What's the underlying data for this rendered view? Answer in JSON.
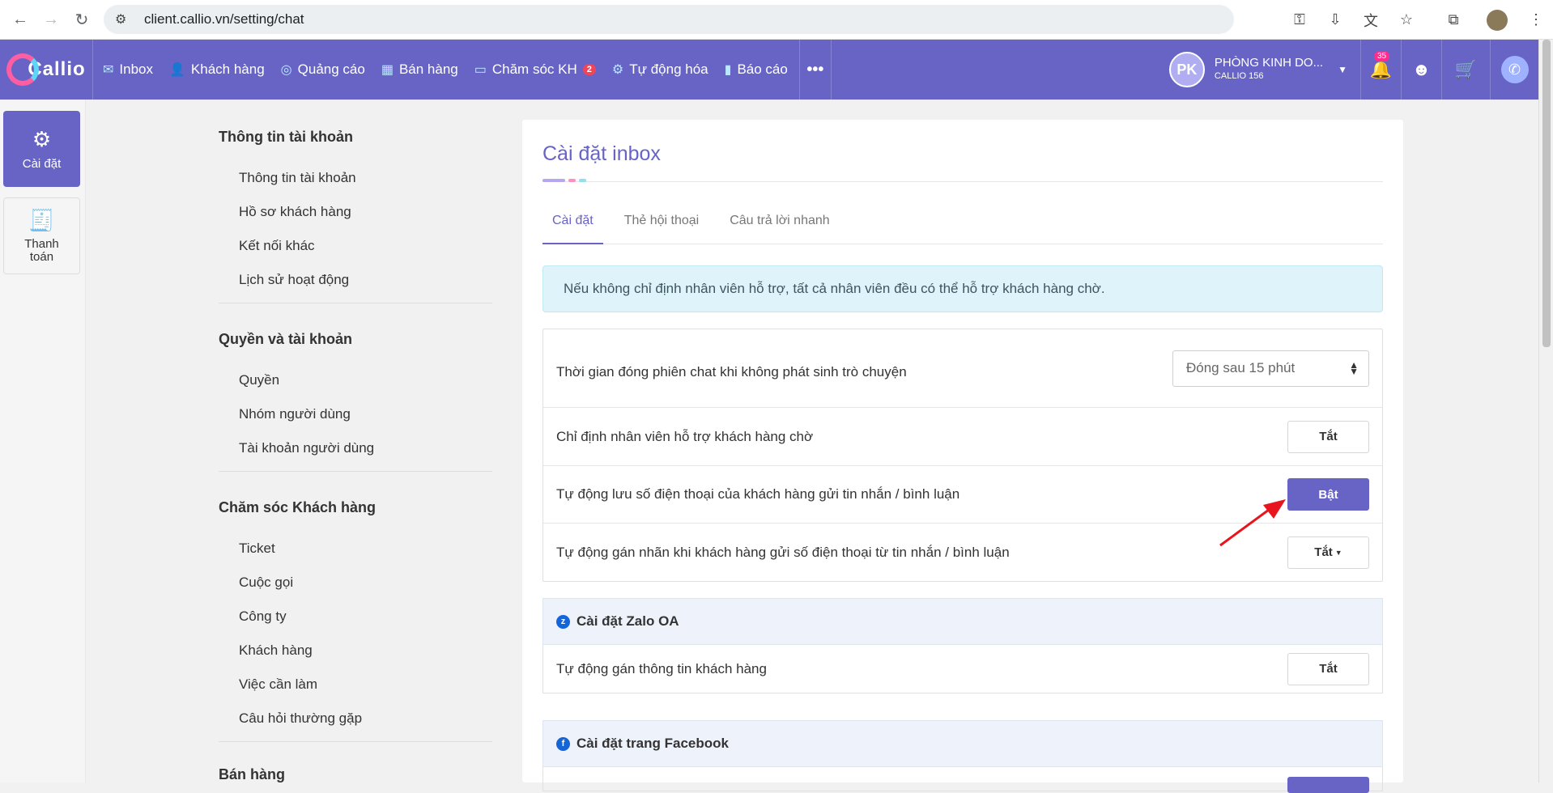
{
  "browser": {
    "url": "client.callio.vn/setting/chat"
  },
  "app": {
    "logo_text": "Callio",
    "menu": [
      {
        "label": "Inbox",
        "icon": "inbox-icon"
      },
      {
        "label": "Khách hàng",
        "icon": "customer-icon"
      },
      {
        "label": "Quảng cáo",
        "icon": "ads-icon"
      },
      {
        "label": "Bán hàng",
        "icon": "sales-icon"
      },
      {
        "label": "Chăm sóc KH",
        "icon": "ticket-icon",
        "badge": "2"
      },
      {
        "label": "Tự động hóa",
        "icon": "robot-icon"
      },
      {
        "label": "Báo cáo",
        "icon": "chart-icon"
      }
    ],
    "more_label": "•••",
    "user": {
      "initials": "PK",
      "name": "PHÒNG KINH DO...",
      "subtitle": "CALLIO 156"
    },
    "notification_count": "35"
  },
  "rail": {
    "settings_label": "Cài đặt",
    "billing_label": "Thanh toán"
  },
  "sidenav": {
    "sections": [
      {
        "title": "Thông tin tài khoản",
        "items": [
          "Thông tin tài khoản",
          "Hồ sơ khách hàng",
          "Kết nối khác",
          "Lịch sử hoạt động"
        ]
      },
      {
        "title": "Quyền và tài khoản",
        "items": [
          "Quyền",
          "Nhóm người dùng",
          "Tài khoản người dùng"
        ]
      },
      {
        "title": "Chăm sóc Khách hàng",
        "items": [
          "Ticket",
          "Cuộc gọi",
          "Công ty",
          "Khách hàng",
          "Việc cần làm",
          "Câu hỏi thường gặp"
        ]
      },
      {
        "title": "Bán hàng",
        "items": []
      }
    ]
  },
  "main": {
    "title": "Cài đặt inbox",
    "tabs": [
      "Cài đặt",
      "Thẻ hội thoại",
      "Câu trả lời nhanh"
    ],
    "alert": "Nếu không chỉ định nhân viên hỗ trợ, tất cả nhân viên đều có thể hỗ trợ khách hàng chờ.",
    "settings": [
      {
        "label": "Thời gian đóng phiên chat khi không phát sinh trò chuyện",
        "control": "select",
        "value": "Đóng sau 15 phút"
      },
      {
        "label": "Chỉ định nhân viên hỗ trợ khách hàng chờ",
        "control": "button",
        "value": "Tắt"
      },
      {
        "label": "Tự động lưu số điện thoại của khách hàng gửi tin nhắn / bình luận",
        "control": "button",
        "value": "Bật"
      },
      {
        "label": "Tự động gán nhãn khi khách hàng gửi số điện thoại từ tin nhắn / bình luận",
        "control": "dropdown-button",
        "value": "Tắt"
      }
    ],
    "zalo": {
      "heading": "Cài đặt Zalo OA",
      "row_label": "Tự động gán thông tin khách hàng",
      "row_value": "Tắt"
    },
    "facebook": {
      "heading": "Cài đặt trang Facebook"
    }
  },
  "colors": {
    "brand": "#6764c6",
    "alert_bg": "#dff4fa",
    "annotation_arrow": "#e8141e"
  }
}
